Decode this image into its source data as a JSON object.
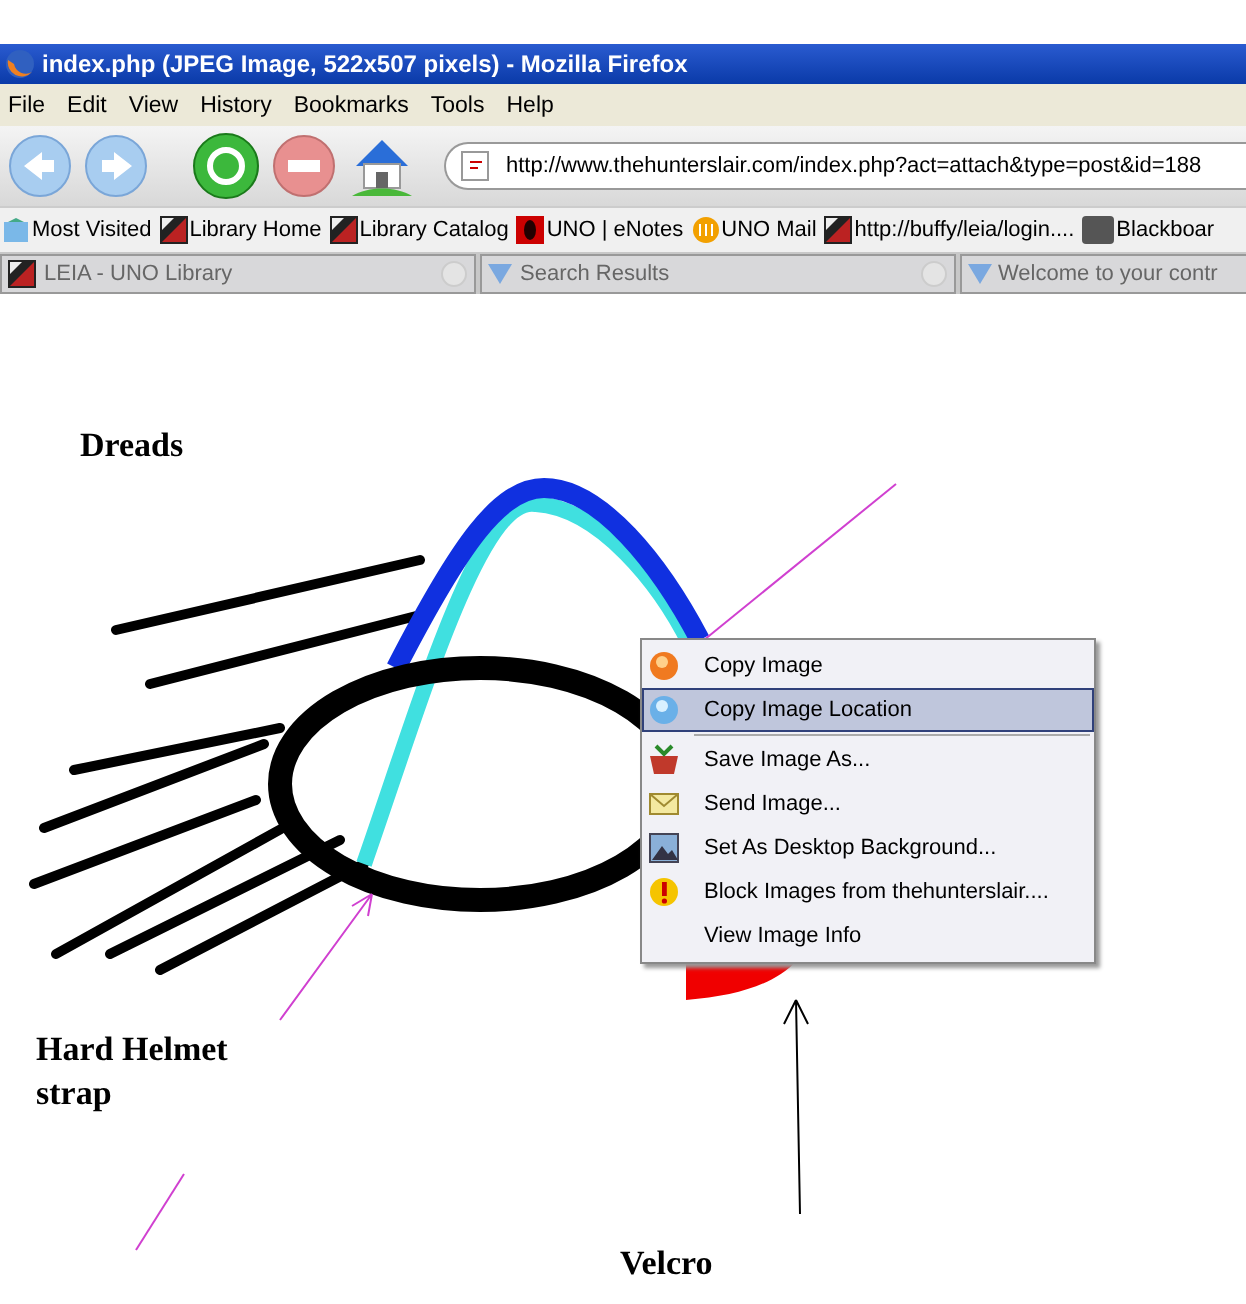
{
  "window": {
    "title": "index.php (JPEG Image, 522x507 pixels) - Mozilla Firefox"
  },
  "menu_bar": [
    "File",
    "Edit",
    "View",
    "History",
    "Bookmarks",
    "Tools",
    "Help"
  ],
  "address_bar": {
    "value": "http://www.thehunterslair.com/index.php?act=attach&type=post&id=188"
  },
  "bookmarks": [
    "Most Visited",
    "Library Home",
    "Library Catalog",
    "UNO | eNotes",
    "UNO Mail",
    "http://buffy/leia/login....",
    "Blackboar"
  ],
  "tabs": [
    {
      "label": "LEIA - UNO Library",
      "selected": false
    },
    {
      "label": "Search Results",
      "selected": false
    },
    {
      "label": "Welcome to your contr",
      "selected": false
    }
  ],
  "drawing": {
    "labels": [
      "Dreads",
      "Hard Helmet",
      "strap",
      "Velcro"
    ]
  },
  "context_menu": [
    {
      "label": "Copy Image",
      "selected": false,
      "separator_before": false
    },
    {
      "label": "Copy Image Location",
      "selected": true,
      "separator_before": false
    },
    {
      "label": "Save Image As...",
      "selected": false,
      "separator_before": true
    },
    {
      "label": "Send Image...",
      "selected": false,
      "separator_before": false
    },
    {
      "label": "Set As Desktop Background...",
      "selected": false,
      "separator_before": false
    },
    {
      "label": "Block Images from thehunterslair....",
      "selected": false,
      "separator_before": false
    },
    {
      "label": "View Image Info",
      "selected": false,
      "separator_before": false
    }
  ]
}
